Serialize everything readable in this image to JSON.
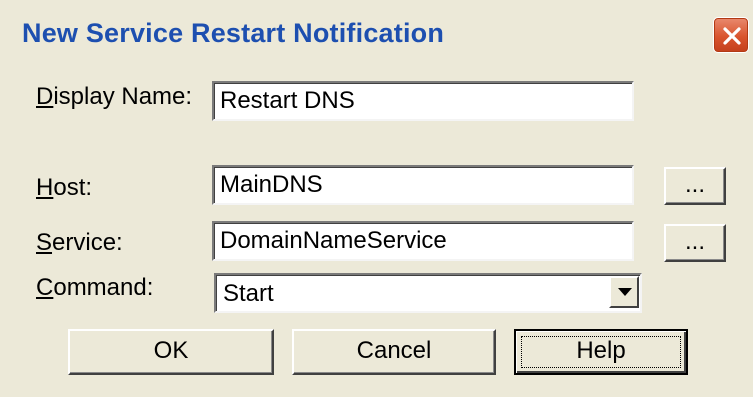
{
  "dialog": {
    "title": "New Service Restart Notification",
    "close_icon": "close-icon"
  },
  "fields": {
    "display_name": {
      "label_ul": "D",
      "label_rest": "isplay Name:",
      "value": "Restart DNS"
    },
    "host": {
      "label_ul": "H",
      "label_rest": "ost:",
      "value": "MainDNS",
      "browse_label": "..."
    },
    "service": {
      "label_ul": "S",
      "label_rest": "ervice:",
      "value": "DomainNameService",
      "browse_label": "..."
    },
    "command": {
      "label_ul": "C",
      "label_rest": "ommand:",
      "value": "Start",
      "arrow_icon": "dropdown-arrow-icon"
    }
  },
  "buttons": {
    "ok": "OK",
    "cancel": "Cancel",
    "help": "Help"
  }
}
